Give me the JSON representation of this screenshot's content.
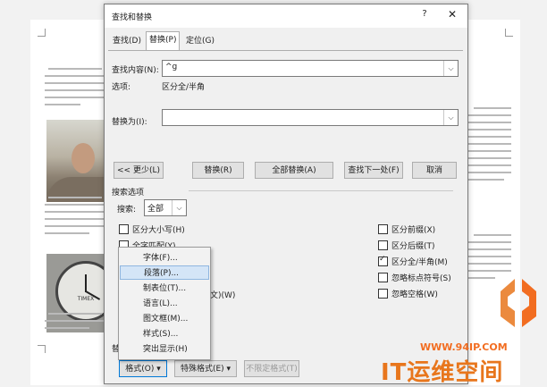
{
  "dialog": {
    "title": "查找和替换",
    "help": "?",
    "close": "✕",
    "tabs": [
      {
        "label": "查找(D)",
        "active": false
      },
      {
        "label": "替换(P)",
        "active": true
      },
      {
        "label": "定位(G)",
        "active": false
      }
    ],
    "find": {
      "label": "查找内容(N):",
      "value": "^g",
      "options_label": "选项:",
      "options_value": "区分全/半角"
    },
    "replace": {
      "label": "替换为(I):",
      "value": ""
    },
    "buttons": {
      "less": "<< 更少(L)",
      "replace": "替换(R)",
      "replace_all": "全部替换(A)",
      "find_next": "查找下一处(F)",
      "cancel": "取消"
    },
    "search_options": {
      "header": "搜索选项",
      "search_label": "搜索:",
      "search_value": "全部",
      "left": [
        {
          "label": "区分大小写(H)",
          "checked": false
        },
        {
          "label": "全字匹配(Y)",
          "checked": false
        }
      ],
      "left_trailing": "文)(W)",
      "right": [
        {
          "label": "区分前缀(X)",
          "checked": false
        },
        {
          "label": "区分后缀(T)",
          "checked": false
        },
        {
          "label": "区分全/半角(M)",
          "checked": true
        },
        {
          "label": "忽略标点符号(S)",
          "checked": false
        },
        {
          "label": "忽略空格(W)",
          "checked": false
        }
      ]
    },
    "replace_section_label": "替",
    "bottom_buttons": {
      "format": "格式(O) ▾",
      "special": "特殊格式(E) ▾",
      "no_format": "不限定格式(T)"
    }
  },
  "format_menu": {
    "items": [
      "字体(F)...",
      "段落(P)...",
      "制表位(T)...",
      "语言(L)...",
      "图文框(M)...",
      "样式(S)...",
      "突出显示(H)"
    ],
    "highlighted_index": 1
  },
  "document": {
    "clock_brand": "TIMEX"
  },
  "watermark": {
    "url": "WWW.94IP.COM",
    "brand": "IT运维空间"
  },
  "colors": {
    "watermark": "#e8761c",
    "menu_highlight": "#d4e5f7"
  }
}
